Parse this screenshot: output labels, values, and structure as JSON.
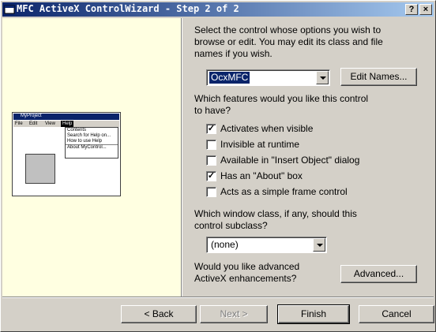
{
  "window": {
    "title": "MFC ActiveX ControlWizard - Step 2 of 2",
    "help_btn": "?",
    "close_btn": "×"
  },
  "preview": {
    "title": "MyProject",
    "menu": [
      "File",
      "Edit",
      "View",
      "Help"
    ],
    "dropdown": [
      "Contents",
      "Search for Help on...",
      "How to use Help",
      "About MyControl..."
    ]
  },
  "intro_lines": [
    "Select the control whose options you wish to",
    "browse or edit.  You may edit its class and file",
    "names if you wish."
  ],
  "control_combo": {
    "value": "OcxMFC"
  },
  "edit_names_label": "Edit Names...",
  "features_lines": [
    "Which features would you like this control",
    "to have?"
  ],
  "features": [
    {
      "label": "Activates when visible",
      "checked": true
    },
    {
      "label": "Invisible at runtime",
      "checked": false
    },
    {
      "label": "Available in \"Insert Object\" dialog",
      "checked": false
    },
    {
      "label": "Has an \"About\" box",
      "checked": true
    },
    {
      "label": "Acts as a simple frame control",
      "checked": false
    }
  ],
  "subclass_lines": [
    "Which window class, if any, should this",
    "control subclass?"
  ],
  "subclass_combo": {
    "value": "(none)"
  },
  "advanced_lines": [
    "Would you like advanced",
    "ActiveX enhancements?"
  ],
  "advanced_label": "Advanced...",
  "buttons": {
    "back": "< Back",
    "next": "Next >",
    "finish": "Finish",
    "cancel": "Cancel"
  }
}
